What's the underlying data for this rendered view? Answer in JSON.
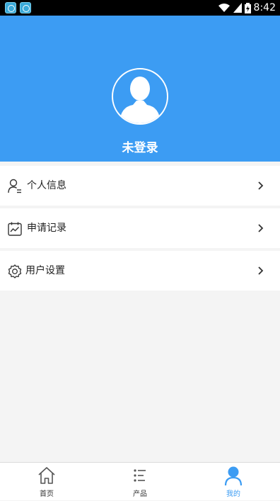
{
  "status_bar": {
    "time": "8:42"
  },
  "header": {
    "login_status": "未登录",
    "color": "#3c9cf3"
  },
  "menu": [
    {
      "label": "个人信息",
      "icon": "user-icon"
    },
    {
      "label": "申请记录",
      "icon": "calendar-chart-icon"
    },
    {
      "label": "用户设置",
      "icon": "gear-icon"
    }
  ],
  "tabbar": {
    "tabs": [
      {
        "label": "首页",
        "icon": "home-icon",
        "active": false
      },
      {
        "label": "产品",
        "icon": "list-icon",
        "active": false
      },
      {
        "label": "我的",
        "icon": "person-icon",
        "active": true
      }
    ],
    "active_color": "#3c9cf3"
  }
}
